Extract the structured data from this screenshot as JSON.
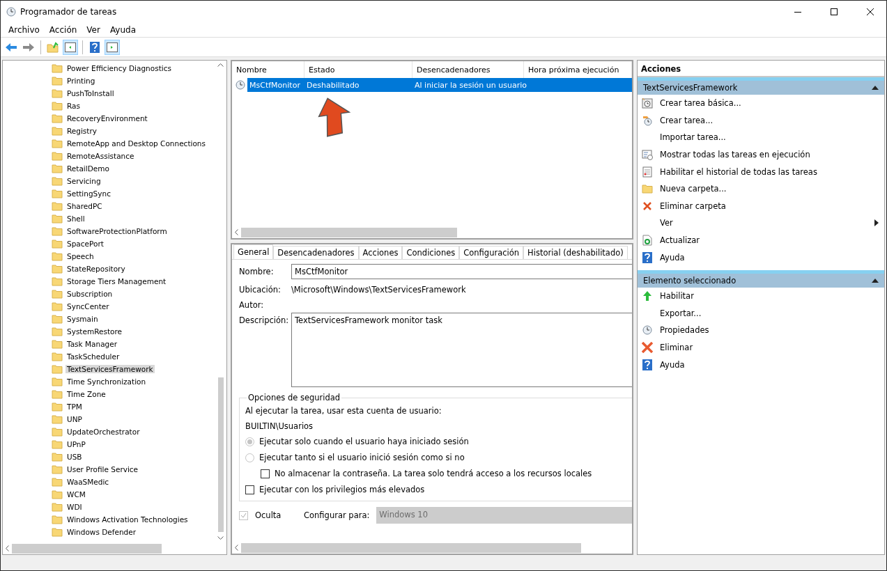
{
  "window": {
    "title": "Programador de tareas"
  },
  "menu": [
    "Archivo",
    "Acción",
    "Ver",
    "Ayuda"
  ],
  "tree": {
    "items": [
      {
        "label": "Power Efficiency Diagnostics",
        "selected": false
      },
      {
        "label": "Printing",
        "selected": false
      },
      {
        "label": "PushToInstall",
        "selected": false
      },
      {
        "label": "Ras",
        "selected": false
      },
      {
        "label": "RecoveryEnvironment",
        "selected": false
      },
      {
        "label": "Registry",
        "selected": false
      },
      {
        "label": "RemoteApp and Desktop Connections",
        "selected": false
      },
      {
        "label": "RemoteAssistance",
        "selected": false
      },
      {
        "label": "RetailDemo",
        "selected": false
      },
      {
        "label": "Servicing",
        "selected": false
      },
      {
        "label": "SettingSync",
        "selected": false
      },
      {
        "label": "SharedPC",
        "selected": false
      },
      {
        "label": "Shell",
        "selected": false
      },
      {
        "label": "SoftwareProtectionPlatform",
        "selected": false
      },
      {
        "label": "SpacePort",
        "selected": false
      },
      {
        "label": "Speech",
        "selected": false
      },
      {
        "label": "StateRepository",
        "selected": false
      },
      {
        "label": "Storage Tiers Management",
        "selected": false
      },
      {
        "label": "Subscription",
        "selected": false
      },
      {
        "label": "SyncCenter",
        "selected": false
      },
      {
        "label": "Sysmain",
        "selected": false
      },
      {
        "label": "SystemRestore",
        "selected": false
      },
      {
        "label": "Task Manager",
        "selected": false
      },
      {
        "label": "TaskScheduler",
        "selected": false
      },
      {
        "label": "TextServicesFramework",
        "selected": true
      },
      {
        "label": "Time Synchronization",
        "selected": false
      },
      {
        "label": "Time Zone",
        "selected": false
      },
      {
        "label": "TPM",
        "selected": false
      },
      {
        "label": "UNP",
        "selected": false
      },
      {
        "label": "UpdateOrchestrator",
        "selected": false
      },
      {
        "label": "UPnP",
        "selected": false
      },
      {
        "label": "USB",
        "selected": false
      },
      {
        "label": "User Profile Service",
        "selected": false
      },
      {
        "label": "WaaSMedic",
        "selected": false
      },
      {
        "label": "WCM",
        "selected": false
      },
      {
        "label": "WDI",
        "selected": false
      },
      {
        "label": "Windows Activation Technologies",
        "selected": false
      },
      {
        "label": "Windows Defender",
        "selected": false
      }
    ]
  },
  "task_list": {
    "columns": [
      "Nombre",
      "Estado",
      "Desencadenadores",
      "Hora próxima ejecución"
    ],
    "rows": [
      {
        "cells": [
          "MsCtfMonitor",
          "Deshabilitado",
          "Al iniciar la sesión un usuario"
        ],
        "selected": true
      }
    ]
  },
  "details": {
    "tabs": [
      {
        "label": "General",
        "selected": true
      },
      {
        "label": "Desencadenadores",
        "selected": false
      },
      {
        "label": "Acciones",
        "selected": false
      },
      {
        "label": "Condiciones",
        "selected": false
      },
      {
        "label": "Configuración",
        "selected": false
      },
      {
        "label": "Historial (deshabilitado)",
        "selected": false
      }
    ],
    "name_label": "Nombre:",
    "name_value": "MsCtfMonitor",
    "location_label": "Ubicación:",
    "location_value": "\\Microsoft\\Windows\\TextServicesFramework",
    "author_label": "Autor:",
    "description_label": "Descripción:",
    "description_value": "TextServicesFramework monitor task",
    "security": {
      "title": "Opciones de seguridad",
      "account_label": "Al ejecutar la tarea, usar esta cuenta de usuario:",
      "account": "BUILTIN\\Usuarios",
      "options": [
        {
          "kind": "radio",
          "label": "Ejecutar solo cuando el usuario haya iniciado sesión",
          "selected": true,
          "indented": false
        },
        {
          "kind": "radio",
          "label": "Ejecutar tanto si el usuario inició sesión como si no",
          "selected": false,
          "indented": false
        },
        {
          "kind": "checkbox",
          "label": "No almacenar la contraseña. La tarea solo tendrá acceso a los recursos locales",
          "checked": false,
          "indented": true
        },
        {
          "kind": "checkbox",
          "label": "Ejecutar con los privilegios más elevados",
          "checked": false,
          "indented": false
        }
      ]
    },
    "hidden": {
      "label": "Oculta",
      "checked": true
    },
    "configure_label": "Configurar para:",
    "configure_value": "Windows 10"
  },
  "actions": {
    "title": "Acciones",
    "sections": [
      {
        "title": "TextServicesFramework",
        "items": [
          {
            "kind": "basic-task",
            "label": "Crear tarea básica..."
          },
          {
            "kind": "task",
            "label": "Crear tarea..."
          },
          {
            "kind": "plain",
            "label": "Importar tarea..."
          },
          {
            "kind": "running",
            "label": "Mostrar todas las tareas en ejecución"
          },
          {
            "kind": "history",
            "label": "Habilitar el historial de todas las tareas"
          },
          {
            "kind": "folder",
            "label": "Nueva carpeta..."
          },
          {
            "kind": "delete-small",
            "label": "Eliminar carpeta"
          },
          {
            "kind": "plain",
            "label": "Ver",
            "submenu": true
          },
          {
            "kind": "refresh",
            "label": "Actualizar"
          },
          {
            "kind": "help",
            "label": "Ayuda"
          }
        ]
      },
      {
        "title": "Elemento seleccionado",
        "items": [
          {
            "kind": "enable",
            "label": "Habilitar"
          },
          {
            "kind": "plain",
            "label": "Exportar..."
          },
          {
            "kind": "clock",
            "label": "Propiedades"
          },
          {
            "kind": "delete-large",
            "label": "Eliminar"
          },
          {
            "kind": "help",
            "label": "Ayuda"
          }
        ]
      }
    ]
  }
}
